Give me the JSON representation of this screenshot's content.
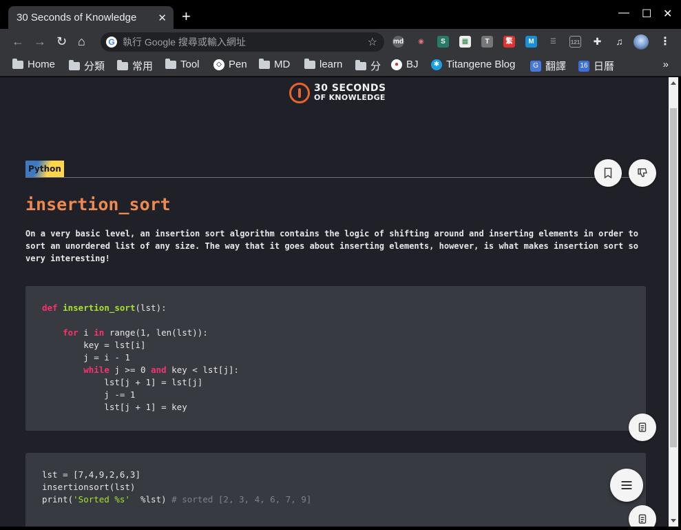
{
  "browser": {
    "tab_title": "30 Seconds of Knowledge",
    "omnibox_placeholder": "執行 Google 搜尋或輸入網址",
    "extensions": [
      "md",
      "S",
      "繁",
      "M",
      "121"
    ],
    "bookmarks": [
      {
        "label": "Home",
        "icon": "folder-icon"
      },
      {
        "label": "分類",
        "icon": "folder-icon"
      },
      {
        "label": "常用",
        "icon": "folder-icon"
      },
      {
        "label": "Tool",
        "icon": "folder-icon"
      },
      {
        "label": "Pen",
        "icon": "codepen-icon"
      },
      {
        "label": "MD",
        "icon": "folder-icon"
      },
      {
        "label": "learn",
        "icon": "folder-icon"
      },
      {
        "label": "分",
        "icon": "folder-icon"
      },
      {
        "label": "BJ",
        "icon": "bj-icon"
      },
      {
        "label": "Titangene Blog",
        "icon": "blog-icon"
      },
      {
        "label": "翻譯",
        "icon": "translate-icon"
      },
      {
        "label": "日曆",
        "icon": "calendar-icon"
      }
    ],
    "more_bookmarks": "»"
  },
  "page": {
    "logo_line1": "30 SECONDS",
    "logo_line2": "OF KNOWLEDGE",
    "language_tag": "Python",
    "snippet_title": "insertion_sort",
    "description": "On a very basic level, an insertion sort algorithm contains the logic of shifting around and inserting elements in order to sort an unordered list of any size. The way that it goes about inserting elements, however, is what makes insertion sort so very interesting!",
    "code_example_comment": "# sorted [2, 3, 4, 6, 7, 9]"
  },
  "colors": {
    "accent": "#f0894e",
    "page_bg": "#202128",
    "code_bg": "#383a42",
    "keyword": "#f8326b",
    "function": "#a6e22e"
  }
}
